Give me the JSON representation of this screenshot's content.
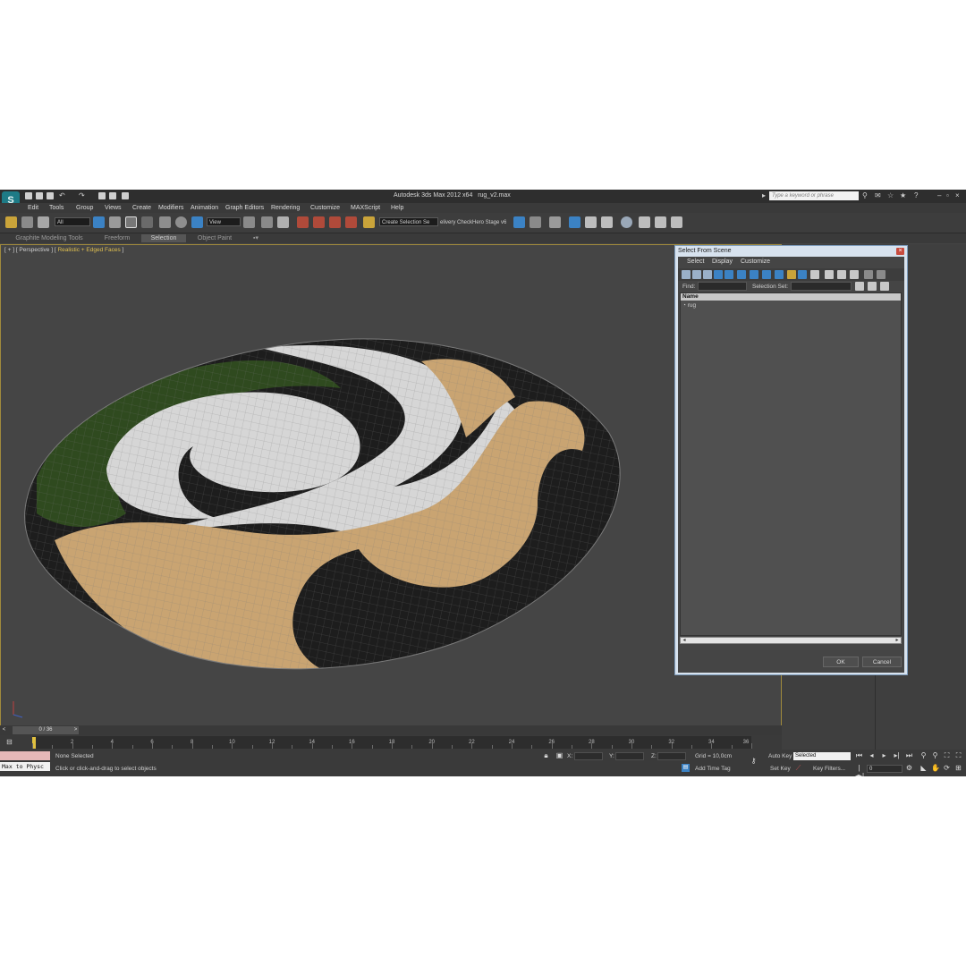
{
  "titlebar": {
    "app_title": "Autodesk 3ds Max  2012 x64",
    "file_name": "rug_v2.max",
    "search_placeholder": "Type a keyword or phrase",
    "logo_text": "S"
  },
  "menu": [
    "Edit",
    "Tools",
    "Group",
    "Views",
    "Create",
    "Modifiers",
    "Animation",
    "Graph Editors",
    "Rendering",
    "Customize",
    "MAXScript",
    "Help"
  ],
  "toolbar": {
    "selection_filter": "All",
    "reference_coord": "View",
    "named_selection": "Create Selection Se",
    "extra_text_1": "elivery Check",
    "extra_text_2": "Hero Stage v6"
  },
  "ribbon_tabs": [
    "Graphite Modeling Tools",
    "Freeform",
    "Selection",
    "Object Paint"
  ],
  "viewport": {
    "label_prefix": "[ + ] [ Perspective ] [",
    "shading": "Realistic + Edged Faces",
    "label_suffix": "]"
  },
  "dialog": {
    "title": "Select From Scene",
    "menu": [
      "Select",
      "Display",
      "Customize"
    ],
    "find_label": "Find:",
    "selection_set_label": "Selection Set:",
    "list_header": "Name",
    "items": [
      "rug"
    ],
    "ok": "OK",
    "cancel": "Cancel"
  },
  "timeline": {
    "frame_indicator": "0 / 36",
    "ticks": [
      "2",
      "4",
      "6",
      "8",
      "10",
      "12",
      "14",
      "16",
      "18",
      "20",
      "22",
      "24",
      "26",
      "28",
      "30",
      "32",
      "34",
      "36"
    ]
  },
  "status": {
    "maxscript": "Max to Physc",
    "selection": "None Selected",
    "prompt": "Click or click-and-drag to select objects",
    "x_label": "X:",
    "y_label": "Y:",
    "z_label": "Z:",
    "grid": "Grid = 10,0cm",
    "add_time_tag": "Add Time Tag",
    "auto_key": "Auto Key",
    "set_key": "Set Key",
    "key_mode": "Selected",
    "key_filters": "Key Filters...",
    "current_frame": "0"
  },
  "colors": {
    "accent": "#3b82c4",
    "viewport_border": "#a08a3c",
    "rug_tan": "#c9a472",
    "rug_white": "#d6d6d6",
    "rug_black": "#1d1d1d",
    "rug_green": "#2f4a1f"
  }
}
